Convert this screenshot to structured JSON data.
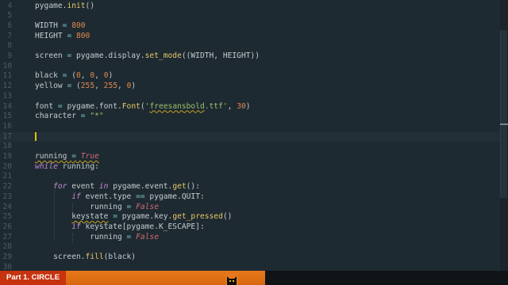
{
  "editor": {
    "lines": [
      {
        "n": "4",
        "tokens": [
          [
            "pu",
            "pygame."
          ],
          [
            "fn",
            "init"
          ],
          [
            "pu",
            "()"
          ]
        ]
      },
      {
        "n": "5",
        "tokens": []
      },
      {
        "n": "6",
        "tokens": [
          [
            "pu",
            "WIDTH "
          ],
          [
            "op",
            "="
          ],
          [
            "pu",
            " "
          ],
          [
            "num",
            "800"
          ]
        ]
      },
      {
        "n": "7",
        "tokens": [
          [
            "pu",
            "HEIGHT "
          ],
          [
            "op",
            "="
          ],
          [
            "pu",
            " "
          ],
          [
            "num",
            "800"
          ]
        ]
      },
      {
        "n": "8",
        "tokens": []
      },
      {
        "n": "9",
        "tokens": [
          [
            "pu",
            "screen "
          ],
          [
            "op",
            "="
          ],
          [
            "pu",
            " pygame.display."
          ],
          [
            "fn",
            "set_mode"
          ],
          [
            "pu",
            "((WIDTH, HEIGHT))"
          ]
        ]
      },
      {
        "n": "10",
        "tokens": []
      },
      {
        "n": "11",
        "tokens": [
          [
            "pu",
            "black "
          ],
          [
            "op",
            "="
          ],
          [
            "pu",
            " ("
          ],
          [
            "num",
            "0"
          ],
          [
            "pu",
            ", "
          ],
          [
            "num",
            "0"
          ],
          [
            "pu",
            ", "
          ],
          [
            "num",
            "0"
          ],
          [
            "pu",
            ")"
          ]
        ]
      },
      {
        "n": "12",
        "tokens": [
          [
            "pu",
            "yellow "
          ],
          [
            "op",
            "="
          ],
          [
            "pu",
            " ("
          ],
          [
            "num",
            "255"
          ],
          [
            "pu",
            ", "
          ],
          [
            "num",
            "255"
          ],
          [
            "pu",
            ", "
          ],
          [
            "num",
            "0"
          ],
          [
            "pu",
            ")"
          ]
        ]
      },
      {
        "n": "13",
        "tokens": []
      },
      {
        "n": "14",
        "tokens": [
          [
            "pu",
            "font "
          ],
          [
            "op",
            "="
          ],
          [
            "pu",
            " pygame.font."
          ],
          [
            "fn",
            "Font"
          ],
          [
            "pu",
            "("
          ],
          [
            "str",
            "'"
          ],
          [
            "str squig",
            "freesansbold"
          ],
          [
            "str",
            ".ttf'"
          ],
          [
            "pu",
            ", "
          ],
          [
            "num",
            "30"
          ],
          [
            "pu",
            ")"
          ]
        ]
      },
      {
        "n": "15",
        "tokens": [
          [
            "pu",
            "character "
          ],
          [
            "op",
            "="
          ],
          [
            "pu",
            " "
          ],
          [
            "str",
            "\"*\""
          ]
        ]
      },
      {
        "n": "16",
        "tokens": []
      },
      {
        "n": "17",
        "tokens": [],
        "cursor": true
      },
      {
        "n": "18",
        "tokens": []
      },
      {
        "n": "19",
        "tokens": [
          [
            "pu squig",
            "running"
          ],
          [
            "pu squig",
            " "
          ],
          [
            "op squig",
            "="
          ],
          [
            "pu squig",
            " "
          ],
          [
            "bool squig",
            "True"
          ]
        ]
      },
      {
        "n": "20",
        "tokens": [
          [
            "kw",
            "while"
          ],
          [
            "pu",
            " running:"
          ]
        ]
      },
      {
        "n": "21",
        "tokens": []
      },
      {
        "n": "22",
        "tokens": [
          [
            "pu",
            "    "
          ],
          [
            "kw",
            "for"
          ],
          [
            "pu",
            " event "
          ],
          [
            "kw",
            "in"
          ],
          [
            "pu",
            " pygame.event."
          ],
          [
            "fn",
            "get"
          ],
          [
            "pu",
            "():"
          ]
        ]
      },
      {
        "n": "23",
        "tokens": [
          [
            "pu",
            "        "
          ],
          [
            "kw",
            "if"
          ],
          [
            "pu",
            " event.type "
          ],
          [
            "op",
            "=="
          ],
          [
            "pu",
            " pygame.QUIT:"
          ]
        ]
      },
      {
        "n": "24",
        "tokens": [
          [
            "pu",
            "            running "
          ],
          [
            "op",
            "="
          ],
          [
            "pu",
            " "
          ],
          [
            "bool",
            "False"
          ]
        ]
      },
      {
        "n": "25",
        "tokens": [
          [
            "pu",
            "        "
          ],
          [
            "pu squig",
            "keystate"
          ],
          [
            "pu",
            " "
          ],
          [
            "op",
            "="
          ],
          [
            "pu",
            " pygame.key."
          ],
          [
            "fn",
            "get_pressed"
          ],
          [
            "pu",
            "()"
          ]
        ]
      },
      {
        "n": "26",
        "tokens": [
          [
            "pu",
            "        "
          ],
          [
            "kw",
            "if"
          ],
          [
            "pu",
            " keystate[pygame.K_ESCAPE]:"
          ]
        ]
      },
      {
        "n": "27",
        "tokens": [
          [
            "pu",
            "            running "
          ],
          [
            "op",
            "="
          ],
          [
            "pu",
            " "
          ],
          [
            "bool",
            "False"
          ]
        ]
      },
      {
        "n": "28",
        "tokens": []
      },
      {
        "n": "29",
        "tokens": [
          [
            "pu",
            "    screen."
          ],
          [
            "fn",
            "fill"
          ],
          [
            "pu",
            "(black)"
          ]
        ]
      },
      {
        "n": "30",
        "tokens": []
      }
    ]
  },
  "video": {
    "title": "Part 1. CIRCLE",
    "progress_fraction": 0.46
  },
  "colors": {
    "background": "#1e2a31",
    "title_badge": "#c7330f",
    "progress": "#e6791c",
    "cursor": "#e8c100"
  },
  "icons": {
    "mascot": "cat-mascot-icon"
  }
}
